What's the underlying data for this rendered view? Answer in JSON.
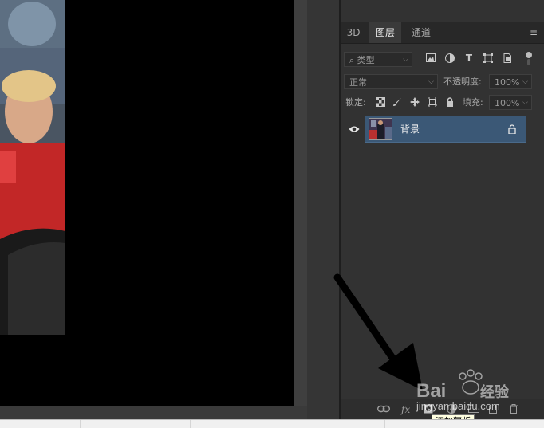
{
  "panel": {
    "tabs": [
      {
        "label": "3D",
        "active": false
      },
      {
        "label": "图层",
        "active": true
      },
      {
        "label": "通道",
        "active": false
      }
    ],
    "menu_icon": "panel-menu-icon",
    "filter": {
      "kind_label": "类型",
      "icons": [
        "image-filter-icon",
        "adjustment-filter-icon",
        "type-filter-icon",
        "shape-filter-icon",
        "smart-object-filter-icon"
      ]
    },
    "blend_mode": "正常",
    "opacity_label": "不透明度:",
    "opacity_value": "100%",
    "lock_label": "锁定:",
    "fill_label": "填充:",
    "fill_value": "100%",
    "layers": [
      {
        "name": "背景",
        "visible": true,
        "locked": true,
        "selected": true
      }
    ]
  },
  "bottom_bar": {
    "link_icon": "link-layers-icon",
    "fx_label": "fx",
    "icons": [
      "link-layers-icon",
      "fx-icon",
      "add-mask-icon",
      "adjustment-layer-icon",
      "new-group-icon",
      "new-layer-icon",
      "delete-layer-icon"
    ]
  },
  "tooltip": {
    "text": "添加蒙版"
  },
  "watermark": {
    "brand": "Bai",
    "brand2": "百",
    "suffix": "经验",
    "url": "jingyan.baidu.com"
  },
  "colors": {
    "selection": "#3b5876",
    "panel_bg": "#323232",
    "canvas_bg": "#000000",
    "tooltip_bg": "#ffffe1"
  }
}
